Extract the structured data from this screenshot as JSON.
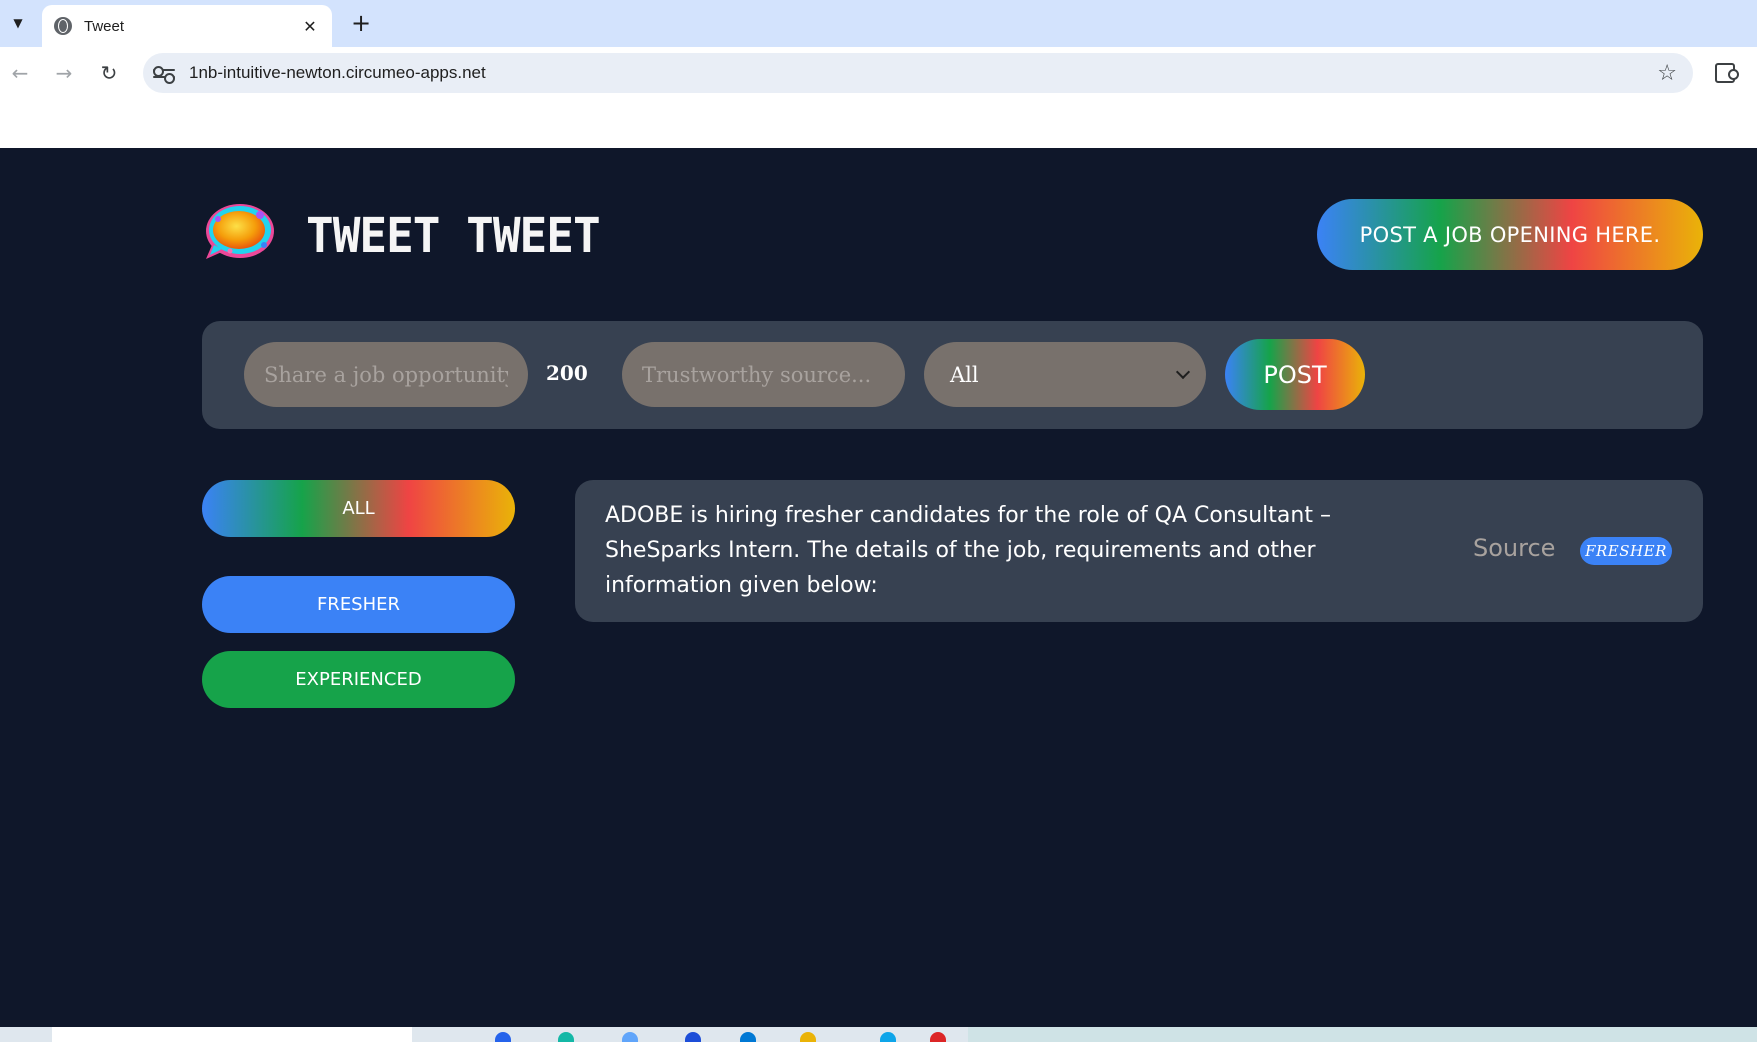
{
  "browser": {
    "tab_title": "Tweet",
    "url": "1nb-intuitive-newton.circumeo-apps.net"
  },
  "header": {
    "brand": "TWEET TWEET",
    "post_opening_label": "POST A JOB OPENING HERE."
  },
  "form": {
    "job_placeholder": "Share a job opportunity yo",
    "char_count": "200",
    "source_placeholder": "Trustworthy source...",
    "category_value": "All",
    "post_label": "POST"
  },
  "filters": {
    "all": "ALL",
    "fresher": "FRESHER",
    "experienced": "EXPERIENCED"
  },
  "posts": [
    {
      "text": "ADOBE is hiring fresher candidates for the role of QA Consultant – SheSparks Intern. The details of the job, requirements and other information given below:",
      "source_label": "Source",
      "tag": "FRESHER"
    }
  ],
  "colors": {
    "background": "#0f172a",
    "panel": "#374151",
    "input": "#78716c",
    "fresher": "#3b82f6",
    "experienced": "#16a34a"
  }
}
